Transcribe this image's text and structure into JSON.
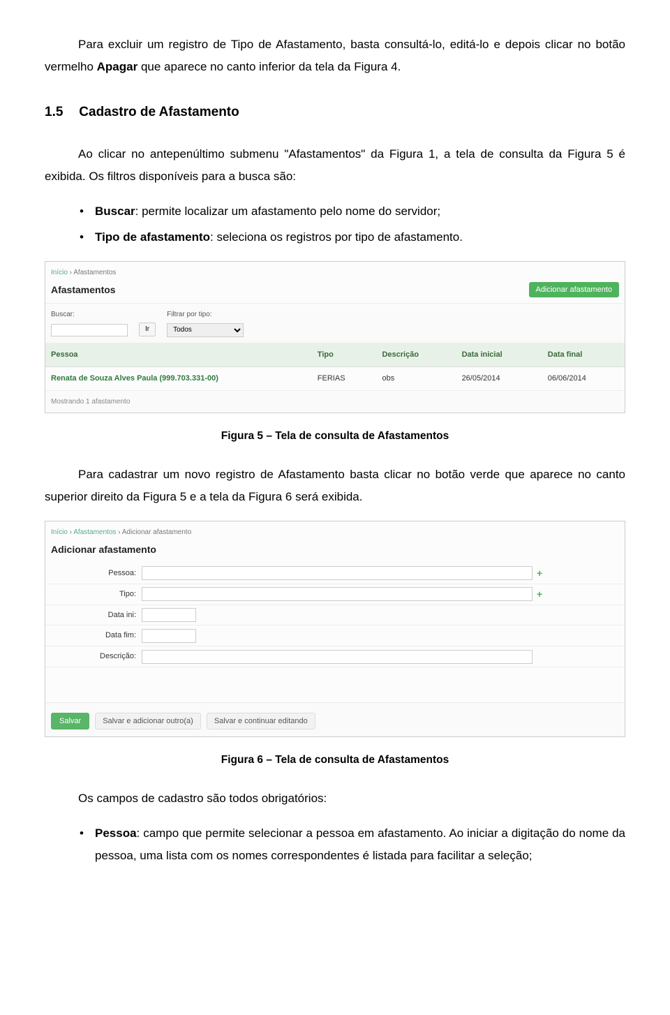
{
  "intro": {
    "p1_a": "Para excluir um registro de Tipo de Afastamento, basta consultá-lo, editá-lo e depois clicar no botão vermelho ",
    "p1_b": "Apagar",
    "p1_c": " que aparece no canto inferior da tela da Figura 4."
  },
  "section": {
    "num": "1.5",
    "title": "Cadastro de Afastamento",
    "p2": "Ao clicar no antepenúltimo submenu \"Afastamentos\" da Figura 1, a tela de consulta da Figura 5 é exibida. Os filtros disponíveis para a busca são:",
    "bullets": [
      {
        "term": "Buscar",
        "desc": ": permite localizar um afastamento pelo nome do servidor;"
      },
      {
        "term": "Tipo de afastamento",
        "desc": ": seleciona os registros por tipo de afastamento."
      }
    ]
  },
  "fig5": {
    "breadcrumb": [
      "Início",
      "Afastamentos"
    ],
    "title": "Afastamentos",
    "add_btn": "Adicionar afastamento",
    "buscar_label": "Buscar:",
    "ir_btn": "Ir",
    "filtrar_label": "Filtrar por tipo:",
    "filtrar_value": "Todos",
    "headers": [
      "Pessoa",
      "Tipo",
      "Descrição",
      "Data inicial",
      "Data final"
    ],
    "row": {
      "pessoa": "Renata de Souza Alves Paula (999.703.331-00)",
      "tipo": "FERIAS",
      "desc": "obs",
      "ini": "26/05/2014",
      "fim": "06/06/2014"
    },
    "footer": "Mostrando 1 afastamento",
    "caption": "Figura 5 – Tela de consulta de Afastamentos"
  },
  "mid": {
    "p3": "Para cadastrar um novo registro de Afastamento basta clicar no botão verde que aparece no canto superior direito da Figura 5 e a tela da Figura 6 será exibida."
  },
  "fig6": {
    "breadcrumb": [
      "Início",
      "Afastamentos",
      "Adicionar afastamento"
    ],
    "title": "Adicionar afastamento",
    "labels": {
      "pessoa": "Pessoa:",
      "tipo": "Tipo:",
      "data_ini": "Data ini:",
      "data_fim": "Data fim:",
      "descricao": "Descrição:"
    },
    "actions": {
      "salvar": "Salvar",
      "salvar_outro": "Salvar e adicionar outro(a)",
      "salvar_editar": "Salvar e continuar editando"
    },
    "caption": "Figura 6 – Tela de consulta de Afastamentos"
  },
  "end": {
    "p4": "Os campos de cadastro são todos obrigatórios:",
    "bullets": [
      {
        "term": "Pessoa",
        "desc": ": campo que permite selecionar a pessoa em afastamento. Ao iniciar a digitação do nome da pessoa, uma lista com os nomes correspondentes é listada para facilitar a seleção;"
      }
    ]
  }
}
